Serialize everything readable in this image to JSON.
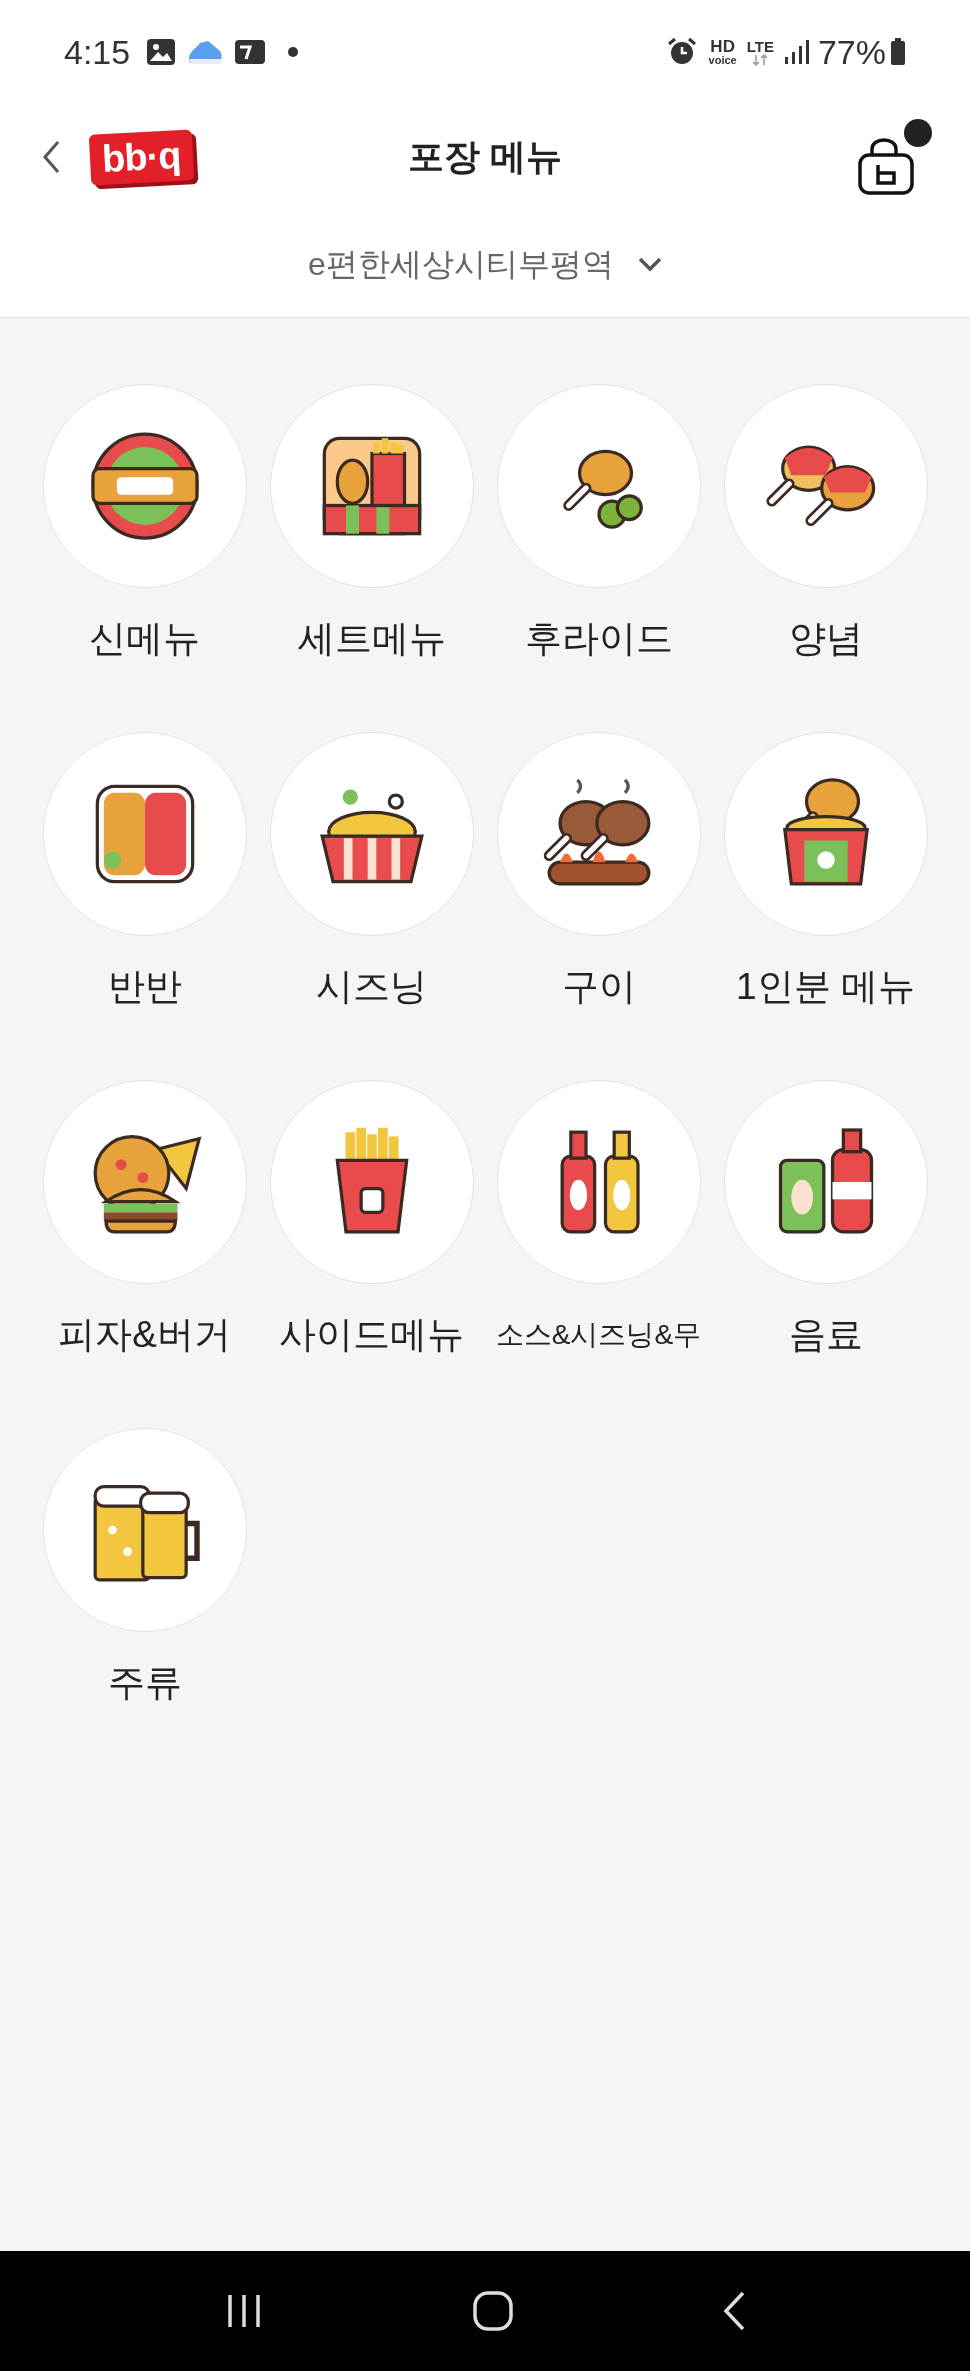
{
  "status_bar": {
    "time": "4:15",
    "hd": "HD",
    "voice": "voice",
    "network": "LTE",
    "battery": "77%"
  },
  "header": {
    "logo": "bb·q",
    "title": "포장 메뉴",
    "store": "e편한세상시티부평역",
    "cart_badge": true
  },
  "categories": [
    {
      "label": "신메뉴",
      "kind": "badge"
    },
    {
      "label": "세트메뉴",
      "kind": "set"
    },
    {
      "label": "후라이드",
      "kind": "fried"
    },
    {
      "label": "양념",
      "kind": "sauced"
    },
    {
      "label": "반반",
      "kind": "half"
    },
    {
      "label": "시즈닝",
      "kind": "seasoning"
    },
    {
      "label": "구이",
      "kind": "grill"
    },
    {
      "label": "1인분 메뉴",
      "kind": "single"
    },
    {
      "label": "피자&버거",
      "kind": "pizza"
    },
    {
      "label": "사이드메뉴",
      "kind": "fries"
    },
    {
      "label": "소스&시즈닝&무",
      "kind": "sauce"
    },
    {
      "label": "음료",
      "kind": "drink"
    },
    {
      "label": "주류",
      "kind": "beer"
    }
  ]
}
